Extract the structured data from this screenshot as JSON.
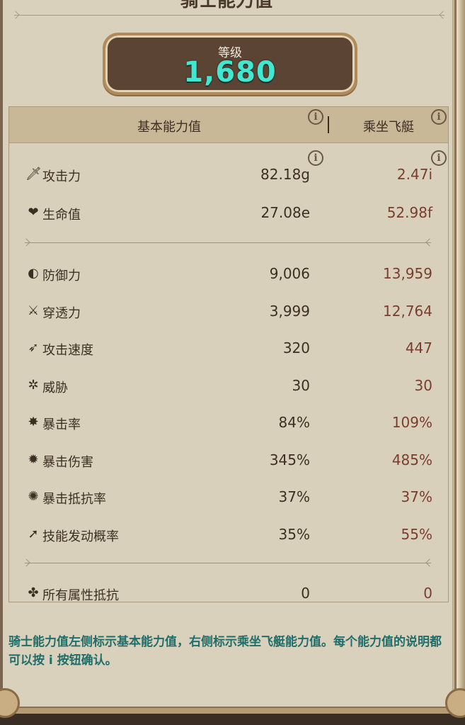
{
  "title": "骑士能力值",
  "level": {
    "label": "等级",
    "value": "1,680"
  },
  "table": {
    "header_base": "基本能力值",
    "header_ride": "乘坐飞艇",
    "info_glyph": "i",
    "rows": [
      {
        "icon": "sword-icon",
        "glyph": "🗡",
        "name": "攻击力",
        "base": "82.18g",
        "ride": "2.47i"
      },
      {
        "icon": "heart-icon",
        "glyph": "❤",
        "name": "生命值",
        "base": "27.08e",
        "ride": "52.98f"
      },
      {
        "icon": "shield-icon",
        "glyph": "◐",
        "name": "防御力",
        "base": "9,006",
        "ride": "13,959"
      },
      {
        "icon": "penetration-icon",
        "glyph": "⚔",
        "name": "穿透力",
        "base": "3,999",
        "ride": "12,764"
      },
      {
        "icon": "attack-speed-icon",
        "glyph": "➶",
        "name": "攻击速度",
        "base": "320",
        "ride": "447"
      },
      {
        "icon": "threat-icon",
        "glyph": "✲",
        "name": "威胁",
        "base": "30",
        "ride": "30"
      },
      {
        "icon": "crit-rate-icon",
        "glyph": "✸",
        "name": "暴击率",
        "base": "84%",
        "ride": "109%"
      },
      {
        "icon": "crit-damage-icon",
        "glyph": "✹",
        "name": "暴击伤害",
        "base": "345%",
        "ride": "485%"
      },
      {
        "icon": "crit-resist-icon",
        "glyph": "✺",
        "name": "暴击抵抗率",
        "base": "37%",
        "ride": "37%"
      },
      {
        "icon": "skill-trigger-icon",
        "glyph": "➚",
        "name": "技能发动概率",
        "base": "35%",
        "ride": "55%"
      },
      {
        "icon": "all-resist-icon",
        "glyph": "✤",
        "name": "所有属性抵抗",
        "base": "0",
        "ride": "0"
      }
    ]
  },
  "note": "骑士能力值左侧标示基本能力值，右侧标示乘坐飞艇能力值。每个能力值的说明都可以按 i 按钮确认。",
  "colors": {
    "accent": "#42e7cf",
    "ride_value": "#7a3d2e",
    "note": "#1f6e6a",
    "plaque": "#5b4433"
  }
}
